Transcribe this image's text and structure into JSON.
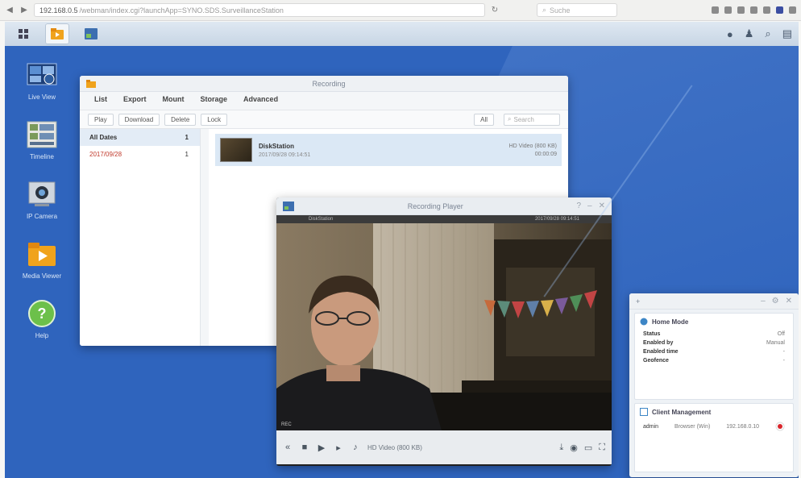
{
  "browser": {
    "url_host": "192.168.0.5",
    "url_path": "/webman/index.cgi?launchApp=SYNO.SDS.SurveillanceStation",
    "search_placeholder": "Suche"
  },
  "desktop": {
    "icons": [
      {
        "label": "Live View",
        "icon": "live-view-icon"
      },
      {
        "label": "Timeline",
        "icon": "timeline-icon"
      },
      {
        "label": "IP Camera",
        "icon": "ip-camera-icon"
      },
      {
        "label": "Media Viewer",
        "icon": "media-viewer-icon"
      },
      {
        "label": "Help",
        "icon": "help-icon"
      }
    ]
  },
  "recordings_window": {
    "title": "Recording",
    "tabs": [
      "List",
      "Export",
      "Mount",
      "Storage",
      "Advanced"
    ],
    "toolbar": [
      "Play",
      "Download",
      "Delete",
      "Lock"
    ],
    "filter_label": "All",
    "search_placeholder": "Search",
    "sidebar": [
      {
        "label": "All Dates",
        "count": "1"
      },
      {
        "label": "2017/09/28",
        "count": "1"
      }
    ],
    "item": {
      "name": "DiskStation",
      "time": "2017/09/28 09:14:51",
      "quality": "HD Video (800 KB)",
      "duration": "00:00:09"
    }
  },
  "player_window": {
    "title": "Recording Player",
    "subtitle_left": "DiskStation",
    "subtitle_right": "2017/09/28 09:14:51",
    "clip_name": "HD Video (800 KB)"
  },
  "widget": {
    "section1_title": "Home Mode",
    "rows": [
      {
        "label": "Status",
        "value": "Off"
      },
      {
        "label": "Enabled by",
        "value": "Manual"
      },
      {
        "label": "Enabled time",
        "value": "-"
      },
      {
        "label": "Geofence",
        "value": "-"
      }
    ],
    "section2_title": "Client Management",
    "client": {
      "user": "admin",
      "app": "Browser (Win)",
      "ip": "192.168.0.10"
    }
  },
  "colors": {
    "desktop": "#2f64bd",
    "accent": "#3c4ea2",
    "record_red": "#d9262c"
  }
}
